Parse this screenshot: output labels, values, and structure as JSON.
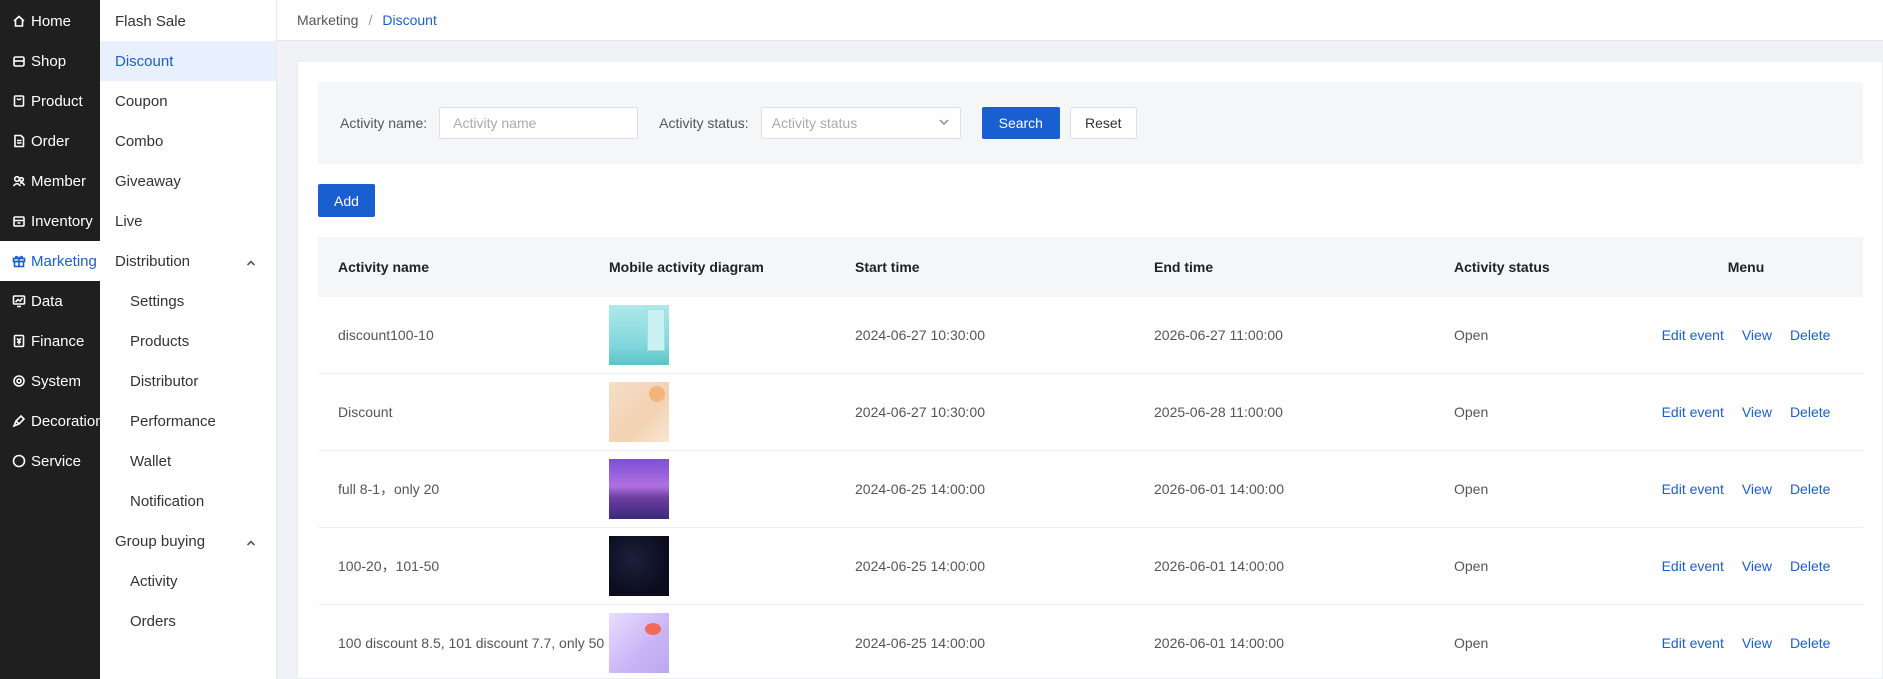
{
  "nav_primary": [
    {
      "label": "Home",
      "icon": "home-icon"
    },
    {
      "label": "Shop",
      "icon": "shop-icon"
    },
    {
      "label": "Product",
      "icon": "product-icon"
    },
    {
      "label": "Order",
      "icon": "order-icon"
    },
    {
      "label": "Member",
      "icon": "member-icon"
    },
    {
      "label": "Inventory",
      "icon": "inventory-icon"
    },
    {
      "label": "Marketing",
      "icon": "gift-icon"
    },
    {
      "label": "Data",
      "icon": "data-icon"
    },
    {
      "label": "Finance",
      "icon": "finance-icon"
    },
    {
      "label": "System",
      "icon": "gear-icon"
    },
    {
      "label": "Decoration",
      "icon": "decoration-icon"
    },
    {
      "label": "Service",
      "icon": "chat-icon"
    }
  ],
  "nav_secondary": {
    "flash_sale": "Flash Sale",
    "discount": "Discount",
    "coupon": "Coupon",
    "combo": "Combo",
    "giveaway": "Giveaway",
    "live": "Live",
    "distribution": "Distribution",
    "distribution_children": [
      "Settings",
      "Products",
      "Distributor",
      "Performance",
      "Wallet",
      "Notification"
    ],
    "group_buying": "Group buying",
    "group_buying_children": [
      "Activity",
      "Orders"
    ]
  },
  "breadcrumb": {
    "parent": "Marketing",
    "separator": "/",
    "current": "Discount"
  },
  "filter": {
    "name_label": "Activity name:",
    "name_placeholder": "Activity name",
    "status_label": "Activity status:",
    "status_placeholder": "Activity status",
    "search_label": "Search",
    "reset_label": "Reset"
  },
  "add_label": "Add",
  "table": {
    "headers": [
      "Activity name",
      "Mobile activity diagram",
      "Start time",
      "End time",
      "Activity status",
      "Menu"
    ],
    "rows": [
      {
        "name": "discount100-10",
        "start": "2024-06-27 10:30:00",
        "end": "2026-06-27 11:00:00",
        "status": "Open"
      },
      {
        "name": "Discount",
        "start": "2024-06-27 10:30:00",
        "end": "2025-06-28 11:00:00",
        "status": "Open"
      },
      {
        "name": "full 8-1，only 20",
        "start": "2024-06-25 14:00:00",
        "end": "2026-06-01 14:00:00",
        "status": "Open"
      },
      {
        "name": "100-20，101-50",
        "start": "2024-06-25 14:00:00",
        "end": "2026-06-01 14:00:00",
        "status": "Open"
      },
      {
        "name": "100 discount 8.5, 101 discount 7.7, only 50",
        "start": "2024-06-25 14:00:00",
        "end": "2026-06-01 14:00:00",
        "status": "Open"
      }
    ],
    "actions": {
      "edit": "Edit event",
      "view": "View",
      "delete": "Delete"
    }
  },
  "colors": {
    "primary": "#1a5fd0",
    "nav_dark": "#1f1f1f"
  }
}
